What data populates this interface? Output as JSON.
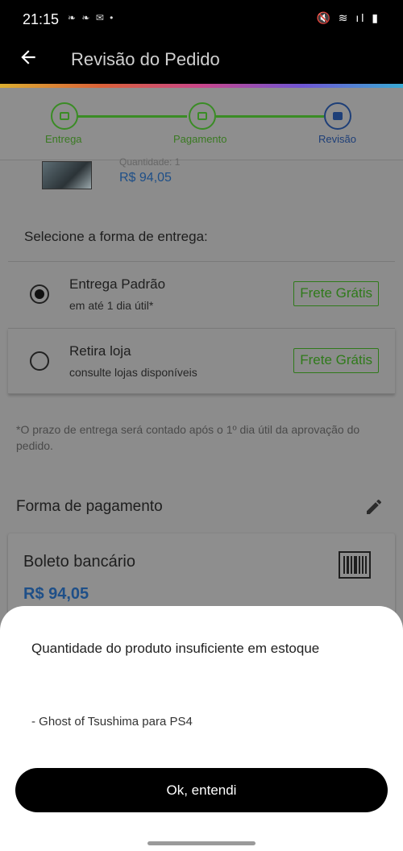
{
  "status_bar": {
    "time": "21:15",
    "notifications": "❧ ❧ ✉ •",
    "system_icons": "🔇 ≋ ıl ▮"
  },
  "app_bar": {
    "back_icon": "arrow-left-icon",
    "title": "Revisão do Pedido"
  },
  "stepper": {
    "steps": [
      {
        "label": "Entrega",
        "icon": "truck-icon",
        "state": "done"
      },
      {
        "label": "Pagamento",
        "icon": "card-icon",
        "state": "done"
      },
      {
        "label": "Revisão",
        "icon": "document-icon",
        "state": "current"
      }
    ],
    "colors": {
      "done": "#3a8c25",
      "current": "#1e3f78"
    }
  },
  "product": {
    "quantity": "Quantidade: 1",
    "price": "R$ 94,05"
  },
  "delivery": {
    "heading": "Selecione a forma de entrega:",
    "options": [
      {
        "name": "Entrega Padrão",
        "detail": "em até 1 dia útil*",
        "badge": "Frete Grátis",
        "selected": true
      },
      {
        "name": "Retira loja",
        "detail": "consulte lojas disponíveis",
        "badge": "Frete Grátis",
        "selected": false
      }
    ],
    "note": "*O prazo de entrega será contado após o 1º dia útil da aprovação do pedido."
  },
  "payment": {
    "heading": "Forma de pagamento",
    "method": "Boleto bancário",
    "price": "R$ 94,05"
  },
  "dialog": {
    "message": "Quantidade do produto insuficiente em estoque",
    "item": "- Ghost of Tsushima para PS4",
    "button": "Ok, entendi"
  }
}
